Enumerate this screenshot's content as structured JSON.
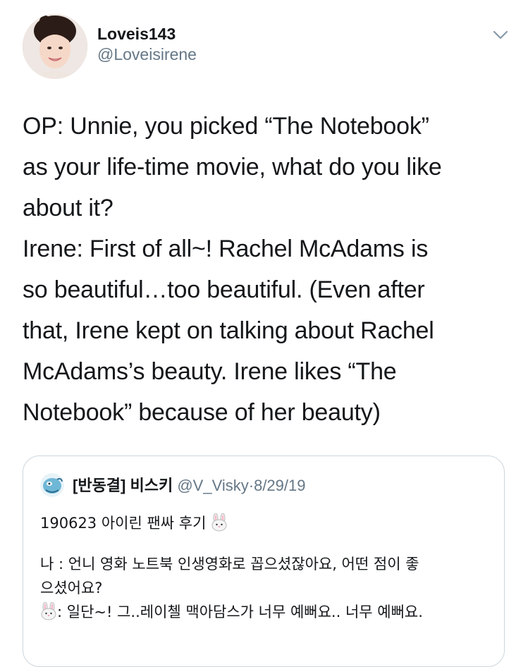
{
  "author": {
    "display_name": "Loveis143",
    "handle": "@Loveisirene"
  },
  "tweet": {
    "lines": [
      "OP: Unnie, you picked “The Notebook”",
      "as your life-time movie, what do you like",
      "about it?",
      "Irene: First of all~! Rachel McAdams is",
      "so beautiful…too beautiful. (Even after",
      "that, Irene kept on talking about Rachel",
      "McAdams’s beauty. Irene likes “The",
      "Notebook” because of her beauty)"
    ]
  },
  "quoted_tweet": {
    "display_name": "[반동결] 비스키",
    "handle": "@V_Visky",
    "separator": "·",
    "date": "8/29/19",
    "line1": "190623 아이린 팬싸 후기",
    "line2": "나 : 언니 영화 노트북 인생영화로 꼽으셨잖아요, 어떤 점이 좋",
    "line3": "으셨어요?",
    "line4": ": 일단~! 그..레이첼 맥아담스가 너무 예뻐요.. 너무 예뻐요."
  },
  "colors": {
    "text_primary": "#14171a",
    "text_secondary": "#657786",
    "border": "#ccd6dd"
  },
  "icons": {
    "caret": "chevron-down-icon",
    "emoji": "rabbit-face-icon"
  }
}
